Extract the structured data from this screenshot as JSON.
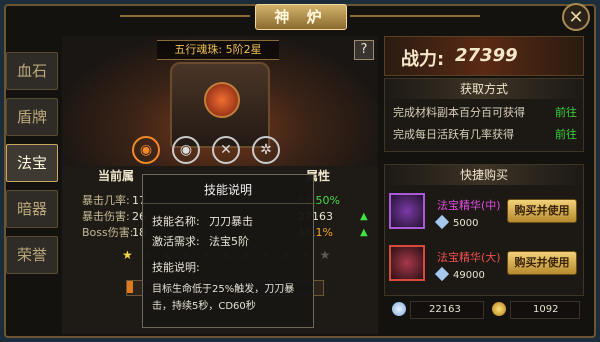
{
  "window": {
    "title": "神 炉",
    "close_icon": "close-icon"
  },
  "sidebar": {
    "tabs": [
      {
        "label": "血石",
        "active": false
      },
      {
        "label": "盾牌",
        "active": false
      },
      {
        "label": "法宝",
        "active": true
      },
      {
        "label": "暗器",
        "active": false
      },
      {
        "label": "荣誉",
        "active": false
      }
    ]
  },
  "stage": {
    "label": "五行魂珠: 5阶2星",
    "help_label": "?"
  },
  "orbs": [
    {
      "icon": "fire-orb-icon",
      "glyph": "◉",
      "color": "#f08a2a"
    },
    {
      "icon": "water-orb-icon",
      "glyph": "◉",
      "color": "#dcdcdc"
    },
    {
      "icon": "wind-orb-icon",
      "glyph": "✕",
      "color": "#dcdcdc"
    },
    {
      "icon": "wood-orb-icon",
      "glyph": "✲",
      "color": "#dcdcdc"
    }
  ],
  "attributes": {
    "current_header": "当前属",
    "next_header": "属性",
    "rows": [
      {
        "label": "暴击几率:",
        "current": "17",
        "next": "17.50%",
        "next_class": "green"
      },
      {
        "label": "暴击伤害:",
        "current": "26",
        "next": "27163",
        "next_class": "val"
      },
      {
        "label": "Boss伤害:",
        "current": "18",
        "next": "18.1%",
        "next_class": "orange"
      }
    ]
  },
  "tooltip": {
    "title": "技能说明",
    "name_label": "技能名称:",
    "name_value": "刀刀暴击",
    "req_label": "激活需求:",
    "req_value": "法宝5阶",
    "desc_label": "技能说明:",
    "desc_text": "目标生命低于25%触发，刀刀暴击，持续5秒，CD60秒"
  },
  "power": {
    "label": "战力:",
    "value": "27399"
  },
  "sources": {
    "header": "获取方式",
    "rows": [
      {
        "text": "完成材料副本百分百可获得",
        "action": "前往"
      },
      {
        "text": "完成每日活跃有几率获得",
        "action": "前往"
      }
    ]
  },
  "quick_buy": {
    "header": "快捷购买",
    "items": [
      {
        "name": "法宝精华(中)",
        "price": "5000",
        "button": "购买并使用",
        "rarity": "purple"
      },
      {
        "name": "法宝精华(大)",
        "price": "49000",
        "button": "购买并使用",
        "rarity": "red"
      }
    ]
  },
  "currency": {
    "gems": "22163",
    "gold": "1092"
  }
}
